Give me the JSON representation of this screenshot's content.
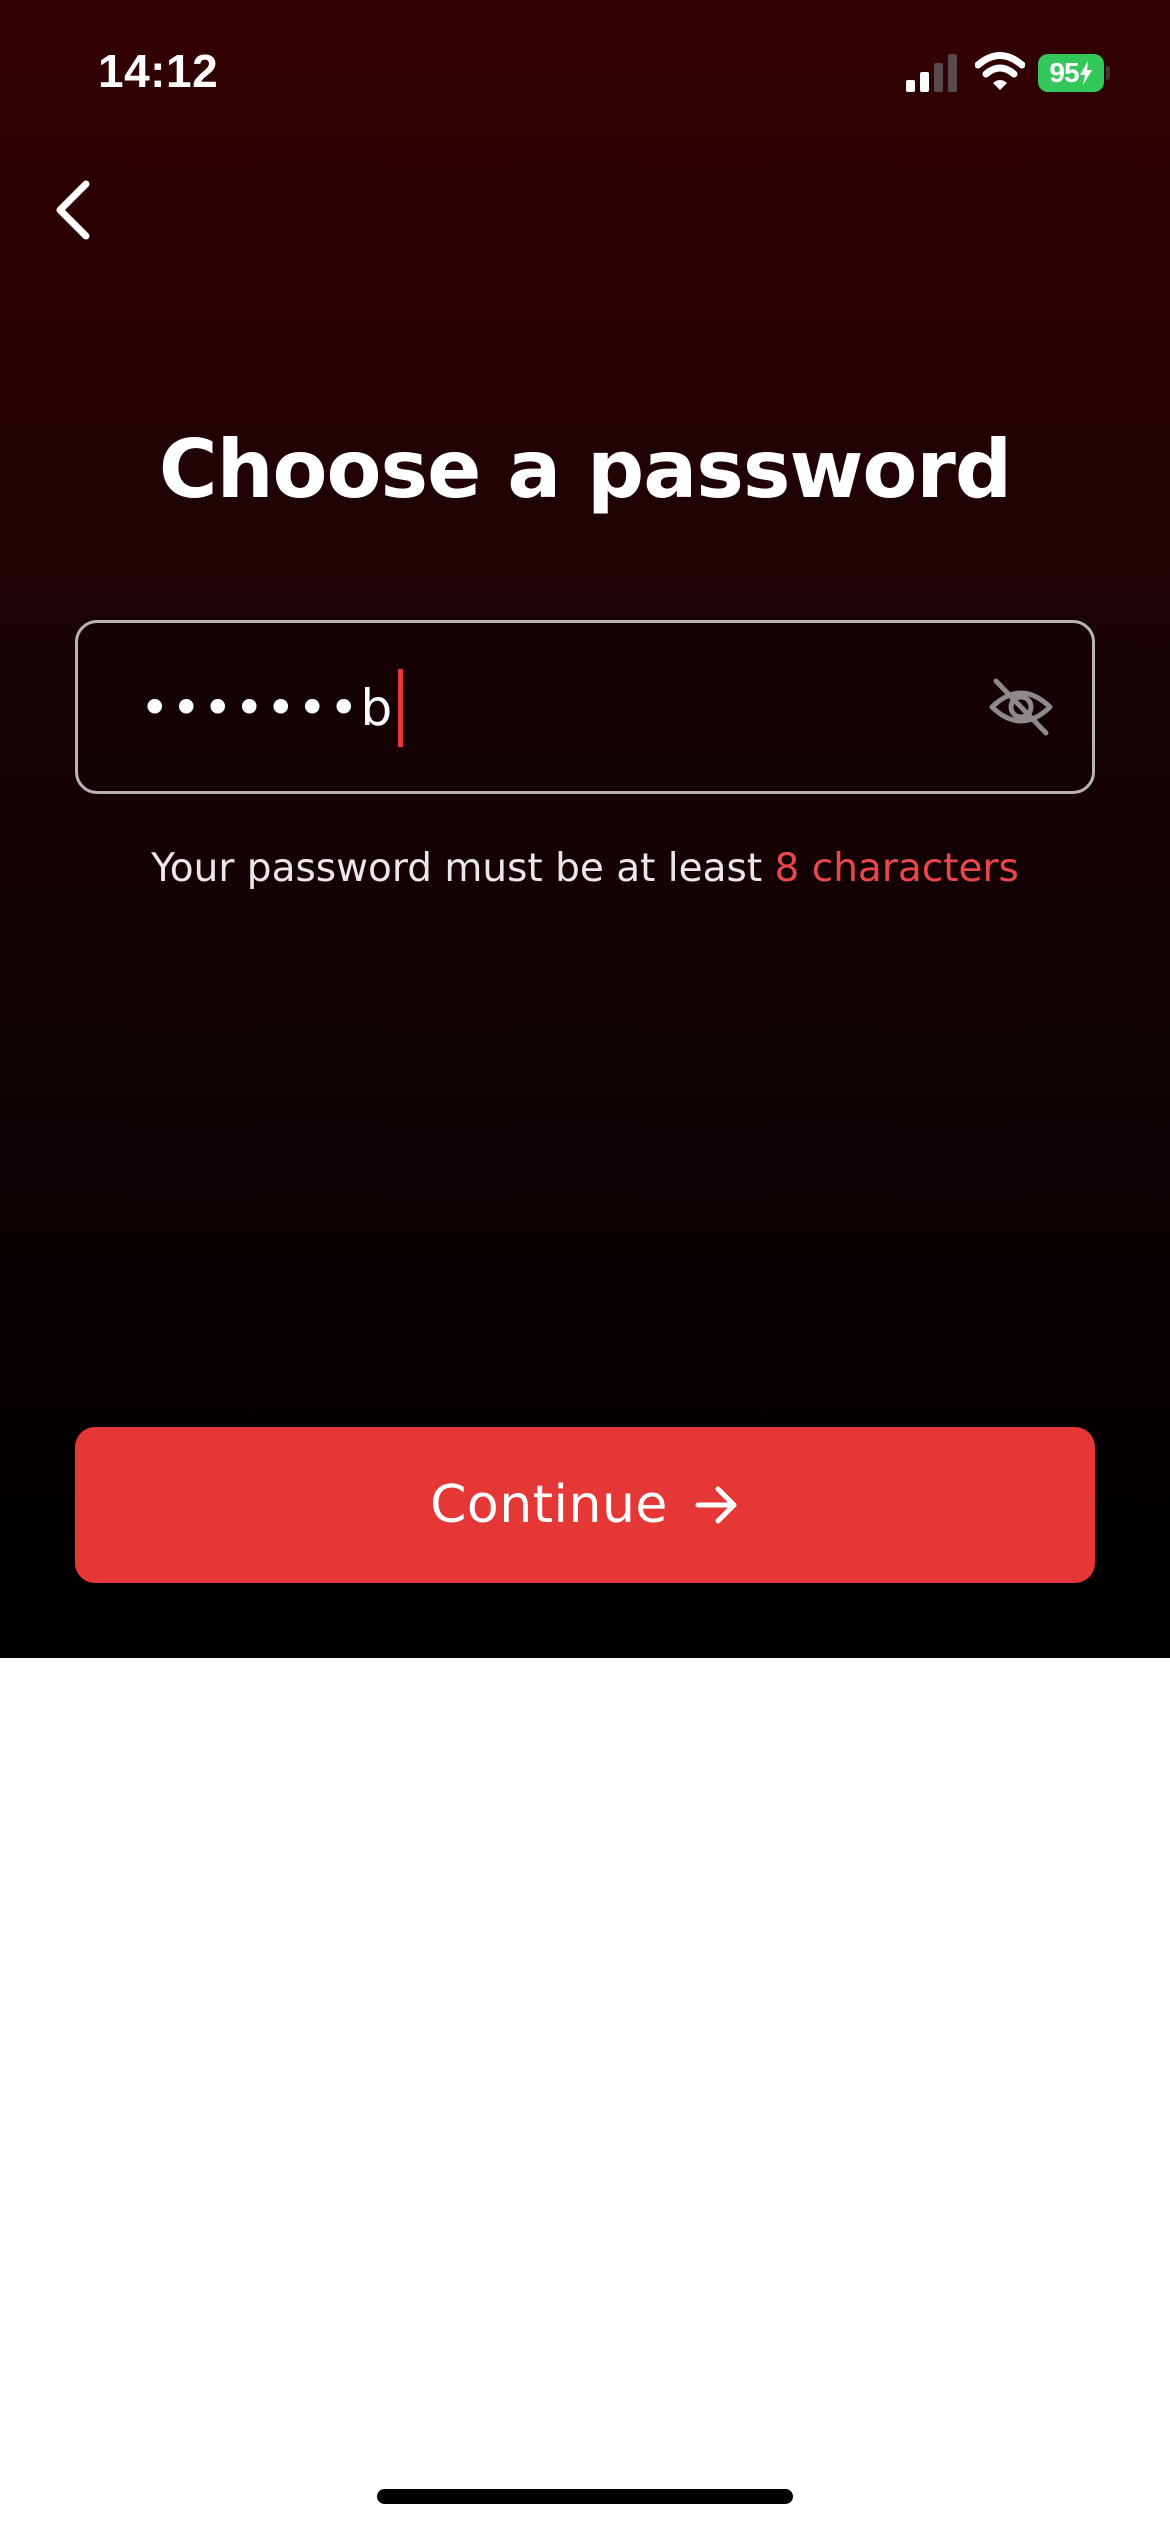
{
  "status_bar": {
    "time": "14:12",
    "battery_level": "95",
    "battery_color": "#34c759",
    "signal_icon": "cellular-signal-icon",
    "wifi_icon": "wifi-icon",
    "battery_icon": "battery-charging-icon"
  },
  "header": {
    "back_icon": "chevron-left-icon"
  },
  "title": "Choose a password",
  "password_field": {
    "value": "•••••••b",
    "visibility_icon": "eye-off-icon"
  },
  "helper": {
    "prefix": "Your password must be at least ",
    "highlight": "8 characters"
  },
  "continue_button": {
    "label": "Continue",
    "icon": "arrow-right-icon"
  },
  "colors": {
    "accent": "#e63737",
    "background_top": "#340204",
    "background_bottom": "#000000"
  }
}
